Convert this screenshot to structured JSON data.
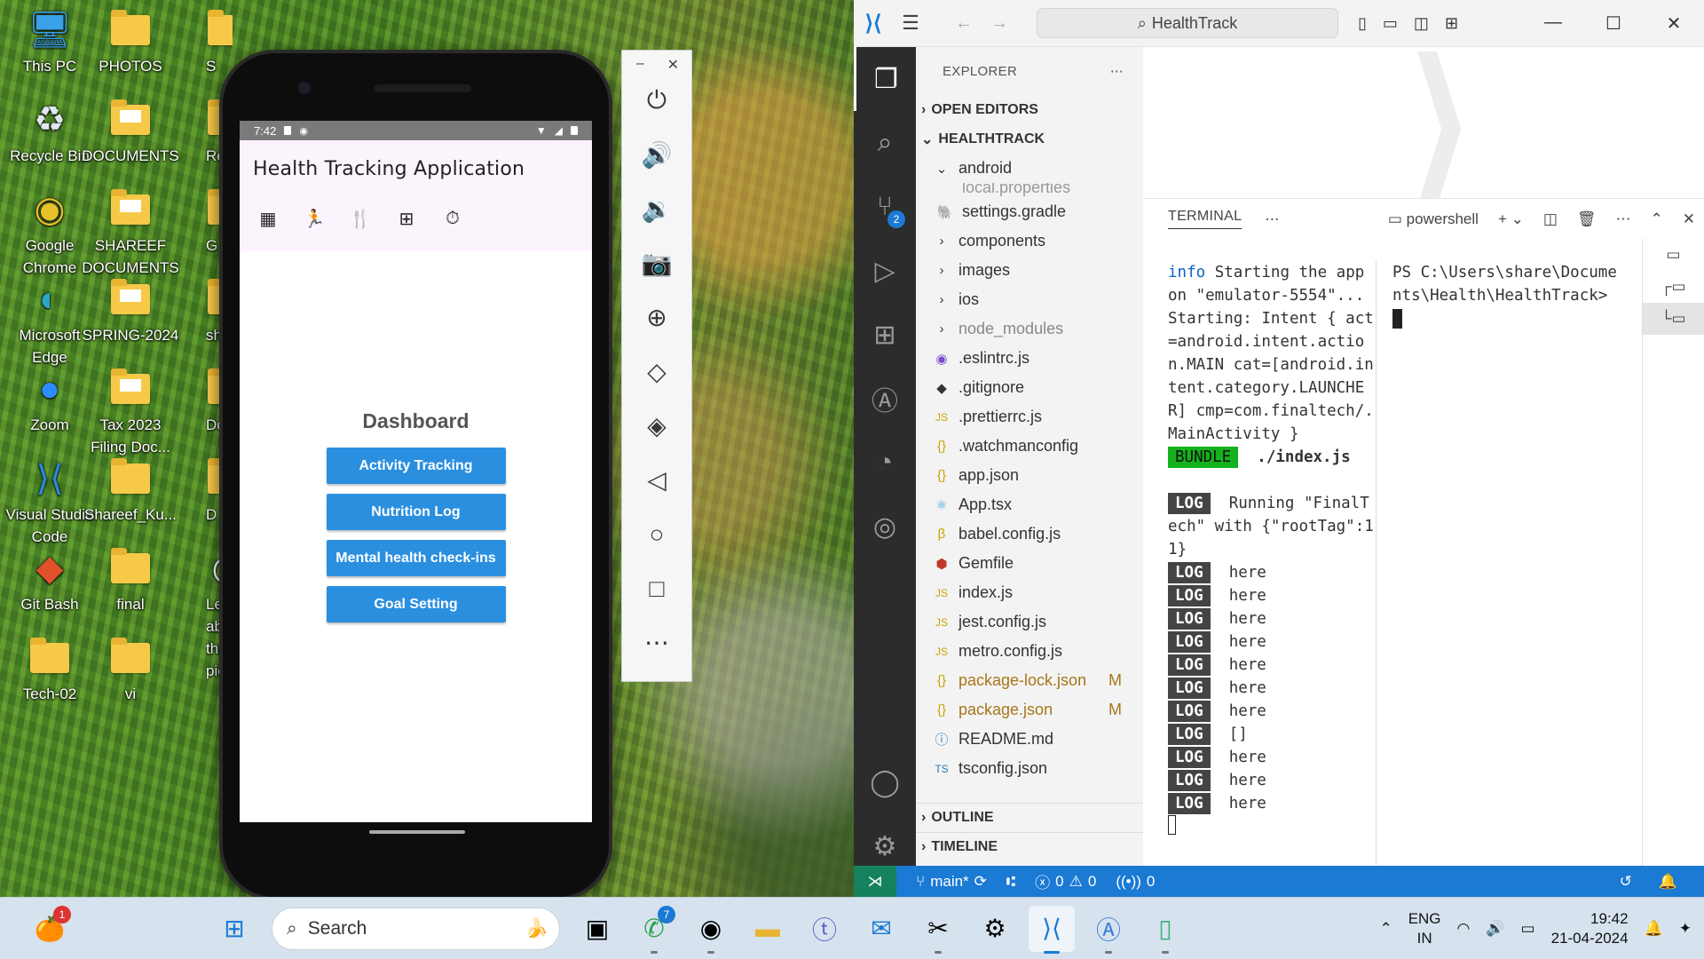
{
  "desktop": {
    "icons": [
      {
        "label": "This PC",
        "icon": "monitor-icon"
      },
      {
        "label": "PHOTOS",
        "icon": "folder-icon"
      },
      {
        "label": "S",
        "icon": "folder-icon"
      },
      {
        "label": "Recycle Bin",
        "icon": "recycle-bin-icon"
      },
      {
        "label": "DOCUMENTS",
        "icon": "folder-icon"
      },
      {
        "label": "Re",
        "icon": "folder-icon"
      },
      {
        "label": "Google Chrome",
        "icon": "chrome-icon"
      },
      {
        "label": "SHAREEF DOCUMENTS",
        "icon": "folder-icon"
      },
      {
        "label": "G",
        "icon": "folder-icon"
      },
      {
        "label": "Microsoft Edge",
        "icon": "edge-icon"
      },
      {
        "label": "SPRING-2024",
        "icon": "folder-icon"
      },
      {
        "label": "sh",
        "icon": "folder-icon"
      },
      {
        "label": "Zoom",
        "icon": "zoom-icon"
      },
      {
        "label": "Tax 2023 Filing Doc...",
        "icon": "folder-icon"
      },
      {
        "label": "Do",
        "icon": "folder-icon"
      },
      {
        "label": "Visual Studio Code",
        "icon": "vscode-icon"
      },
      {
        "label": "Shareef_Ku...",
        "icon": "folder-icon"
      },
      {
        "label": "D",
        "icon": "folder-icon"
      },
      {
        "label": "Git Bash",
        "icon": "git-bash-icon"
      },
      {
        "label": "final",
        "icon": "folder-icon"
      },
      {
        "label": "Learn about this picture",
        "icon": "camera-icon"
      },
      {
        "label": "Tech-02",
        "icon": "folder-icon"
      },
      {
        "label": "vi",
        "icon": "folder-icon"
      }
    ]
  },
  "phone": {
    "status_time": "7:42",
    "app_title": "Health Tracking Application",
    "tab_icons": [
      "dashboard-icon",
      "run-icon",
      "utensils-icon",
      "medical-icon",
      "timer-icon"
    ],
    "dashboard_heading": "Dashboard",
    "buttons": [
      "Activity Tracking",
      "Nutrition Log",
      "Mental health check-ins",
      "Goal Setting"
    ]
  },
  "emulator_toolbar": {
    "tools": [
      "power-icon",
      "volume-up-icon",
      "volume-down-icon",
      "camera-icon",
      "zoom-icon",
      "rotate-left-icon",
      "rotate-right-icon",
      "back-icon",
      "home-icon",
      "overview-icon",
      "more-icon"
    ]
  },
  "vscode": {
    "search_text": "HealthTrack",
    "explorer_title": "EXPLORER",
    "open_editors": "OPEN EDITORS",
    "project": "HEALTHTRACK",
    "tree": [
      {
        "label": "android",
        "kind": "folder-open",
        "indent": 1
      },
      {
        "label": "local.properties",
        "kind": "file",
        "indent": 2,
        "partial": true
      },
      {
        "label": "settings.gradle",
        "kind": "gradle",
        "indent": 2
      },
      {
        "label": "components",
        "kind": "folder",
        "indent": 1
      },
      {
        "label": "images",
        "kind": "folder",
        "indent": 1
      },
      {
        "label": "ios",
        "kind": "folder",
        "indent": 1
      },
      {
        "label": "node_modules",
        "kind": "folder-muted",
        "indent": 1
      },
      {
        "label": ".eslintrc.js",
        "kind": "eslint",
        "indent": 1
      },
      {
        "label": ".gitignore",
        "kind": "git",
        "indent": 1
      },
      {
        "label": ".prettierrc.js",
        "kind": "js",
        "indent": 1
      },
      {
        "label": ".watchmanconfig",
        "kind": "json",
        "indent": 1
      },
      {
        "label": "app.json",
        "kind": "json",
        "indent": 1
      },
      {
        "label": "App.tsx",
        "kind": "react",
        "indent": 1
      },
      {
        "label": "babel.config.js",
        "kind": "babel",
        "indent": 1
      },
      {
        "label": "Gemfile",
        "kind": "ruby",
        "indent": 1
      },
      {
        "label": "index.js",
        "kind": "js",
        "indent": 1
      },
      {
        "label": "jest.config.js",
        "kind": "js",
        "indent": 1
      },
      {
        "label": "metro.config.js",
        "kind": "js",
        "indent": 1
      },
      {
        "label": "package-lock.json",
        "kind": "json",
        "indent": 1,
        "status": "M"
      },
      {
        "label": "package.json",
        "kind": "json",
        "indent": 1,
        "status": "M"
      },
      {
        "label": "README.md",
        "kind": "info",
        "indent": 1
      },
      {
        "label": "tsconfig.json",
        "kind": "ts",
        "indent": 1
      }
    ],
    "outline": "OUTLINE",
    "timeline": "TIMELINE",
    "terminal_tab": "TERMINAL",
    "terminal_shell": "powershell",
    "terminal_lines": [
      {
        "tag": "info",
        "text": "Starting the app on \"emulator-5554\"..."
      },
      {
        "tag": "",
        "text": "Starting: Intent { act=android.intent.action.MAIN cat=[android.intent.category.LAUNCHER] cmp=com.finaltech/.MainActivity }"
      },
      {
        "tag": "BUNDLE",
        "text": "./index.js"
      },
      {
        "tag": "",
        "text": " "
      },
      {
        "tag": "LOG",
        "text": "Running \"FinalTech\" with {\"rootTag\":11}"
      },
      {
        "tag": "LOG",
        "text": "here"
      },
      {
        "tag": "LOG",
        "text": "here"
      },
      {
        "tag": "LOG",
        "text": "here"
      },
      {
        "tag": "LOG",
        "text": "here"
      },
      {
        "tag": "LOG",
        "text": "here"
      },
      {
        "tag": "LOG",
        "text": "here"
      },
      {
        "tag": "LOG",
        "text": "here"
      },
      {
        "tag": "LOG",
        "text": "[]"
      },
      {
        "tag": "LOG",
        "text": "here"
      },
      {
        "tag": "LOG",
        "text": "here"
      },
      {
        "tag": "LOG",
        "text": "here"
      }
    ],
    "terminal2_prompt": "PS C:\\Users\\share\\Documents\\Health\\HealthTrack>",
    "status": {
      "branch": "main*",
      "errors": "0",
      "warnings": "0",
      "ports": "0"
    }
  },
  "taskbar": {
    "search_placeholder": "Search",
    "apps": [
      {
        "name": "widgets-icon",
        "badge": "1"
      },
      {
        "name": "start-icon"
      },
      {
        "name": "search"
      },
      {
        "name": "weather-icon"
      },
      {
        "name": "task-view-icon"
      },
      {
        "name": "whatsapp-icon",
        "badge": "7"
      },
      {
        "name": "chrome-icon"
      },
      {
        "name": "file-explorer-icon"
      },
      {
        "name": "teams-icon"
      },
      {
        "name": "outlook-icon"
      },
      {
        "name": "snipping-tool-icon"
      },
      {
        "name": "settings-icon"
      },
      {
        "name": "vscode-icon",
        "active": true
      },
      {
        "name": "android-studio-icon"
      },
      {
        "name": "emulator-icon"
      }
    ],
    "lang_line1": "ENG",
    "lang_line2": "IN",
    "time": "19:42",
    "date": "21-04-2024"
  },
  "colors": {
    "vscode_blue": "#1a7ad4",
    "button_blue": "#2b8fe0",
    "bundle_green": "#15b21d",
    "modified": "#a8751c"
  }
}
